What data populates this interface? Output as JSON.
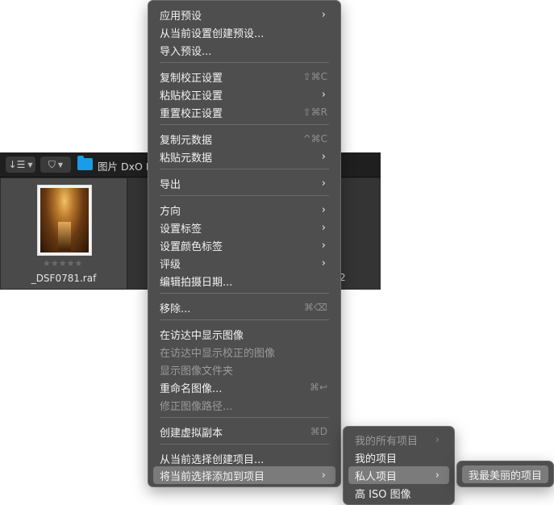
{
  "app": {
    "folder_label": "图片 DxO F",
    "thumbnail": {
      "filename": "_DSF0781.raf",
      "stars": "★★★★★"
    },
    "second_item_label": "2",
    "colors": {
      "toolbar": "#1f1f1f",
      "browser": "#2b2b2b",
      "selected_cell": "#4a4a4a",
      "folder": "#1a9ce6"
    }
  },
  "icons": {
    "sort": "sort-icon",
    "filter": "filter-icon",
    "folder": "folder-icon",
    "submenu": "chevron-right-icon"
  },
  "context_menu": {
    "items": [
      {
        "label": "应用预设",
        "submenu": true
      },
      {
        "label": "从当前设置创建预设..."
      },
      {
        "label": "导入预设..."
      },
      {
        "label": "复制校正设置",
        "shortcut": "⇧⌘C"
      },
      {
        "label": "粘贴校正设置",
        "submenu": true
      },
      {
        "label": "重置校正设置",
        "shortcut": "⇧⌘R"
      },
      {
        "label": "复制元数据",
        "shortcut": "^⌘C"
      },
      {
        "label": "粘贴元数据",
        "submenu": true
      },
      {
        "label": "导出",
        "submenu": true
      },
      {
        "label": "方向",
        "submenu": true
      },
      {
        "label": "设置标签",
        "submenu": true
      },
      {
        "label": "设置颜色标签",
        "submenu": true
      },
      {
        "label": "评级",
        "submenu": true
      },
      {
        "label": "编辑拍摄日期..."
      },
      {
        "label": "移除...",
        "shortcut": "⌘⌫"
      },
      {
        "label": "在访达中显示图像"
      },
      {
        "label": "在访达中显示校正的图像",
        "disabled": true
      },
      {
        "label": "显示图像文件夹",
        "disabled": true
      },
      {
        "label": "重命名图像...",
        "shortcut": "⌘↩"
      },
      {
        "label": "修正图像路径...",
        "disabled": true
      },
      {
        "label": "创建虚拟副本",
        "shortcut": "⌘D"
      },
      {
        "label": "从当前选择创建项目..."
      },
      {
        "label": "将当前选择添加到项目",
        "submenu": true,
        "selected": true
      }
    ]
  },
  "projects_menu": {
    "items": [
      {
        "label": "我的所有项目",
        "submenu": true,
        "disabled": true
      },
      {
        "label": "我的项目"
      },
      {
        "label": "私人项目",
        "submenu": true,
        "selected": true
      },
      {
        "label": "高 ISO 图像"
      }
    ]
  },
  "private_menu": {
    "items": [
      {
        "label": "我最美丽的项目",
        "selected": true
      }
    ]
  },
  "chevron_glyph": "›"
}
